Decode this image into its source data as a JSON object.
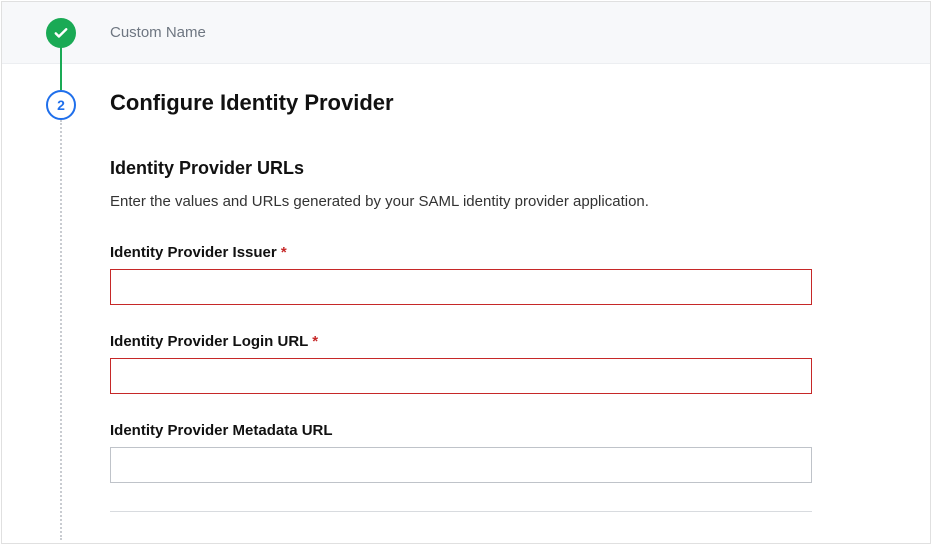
{
  "step1": {
    "label": "Custom Name"
  },
  "step2": {
    "number": "2",
    "title": "Configure Identity Provider"
  },
  "section": {
    "title": "Identity Provider URLs",
    "description": "Enter the values and URLs generated by your SAML identity provider application."
  },
  "fields": {
    "issuer": {
      "label": "Identity Provider Issuer",
      "required": "*",
      "value": ""
    },
    "login_url": {
      "label": "Identity Provider Login URL",
      "required": "*",
      "value": ""
    },
    "metadata_url": {
      "label": "Identity Provider Metadata URL",
      "value": ""
    }
  }
}
